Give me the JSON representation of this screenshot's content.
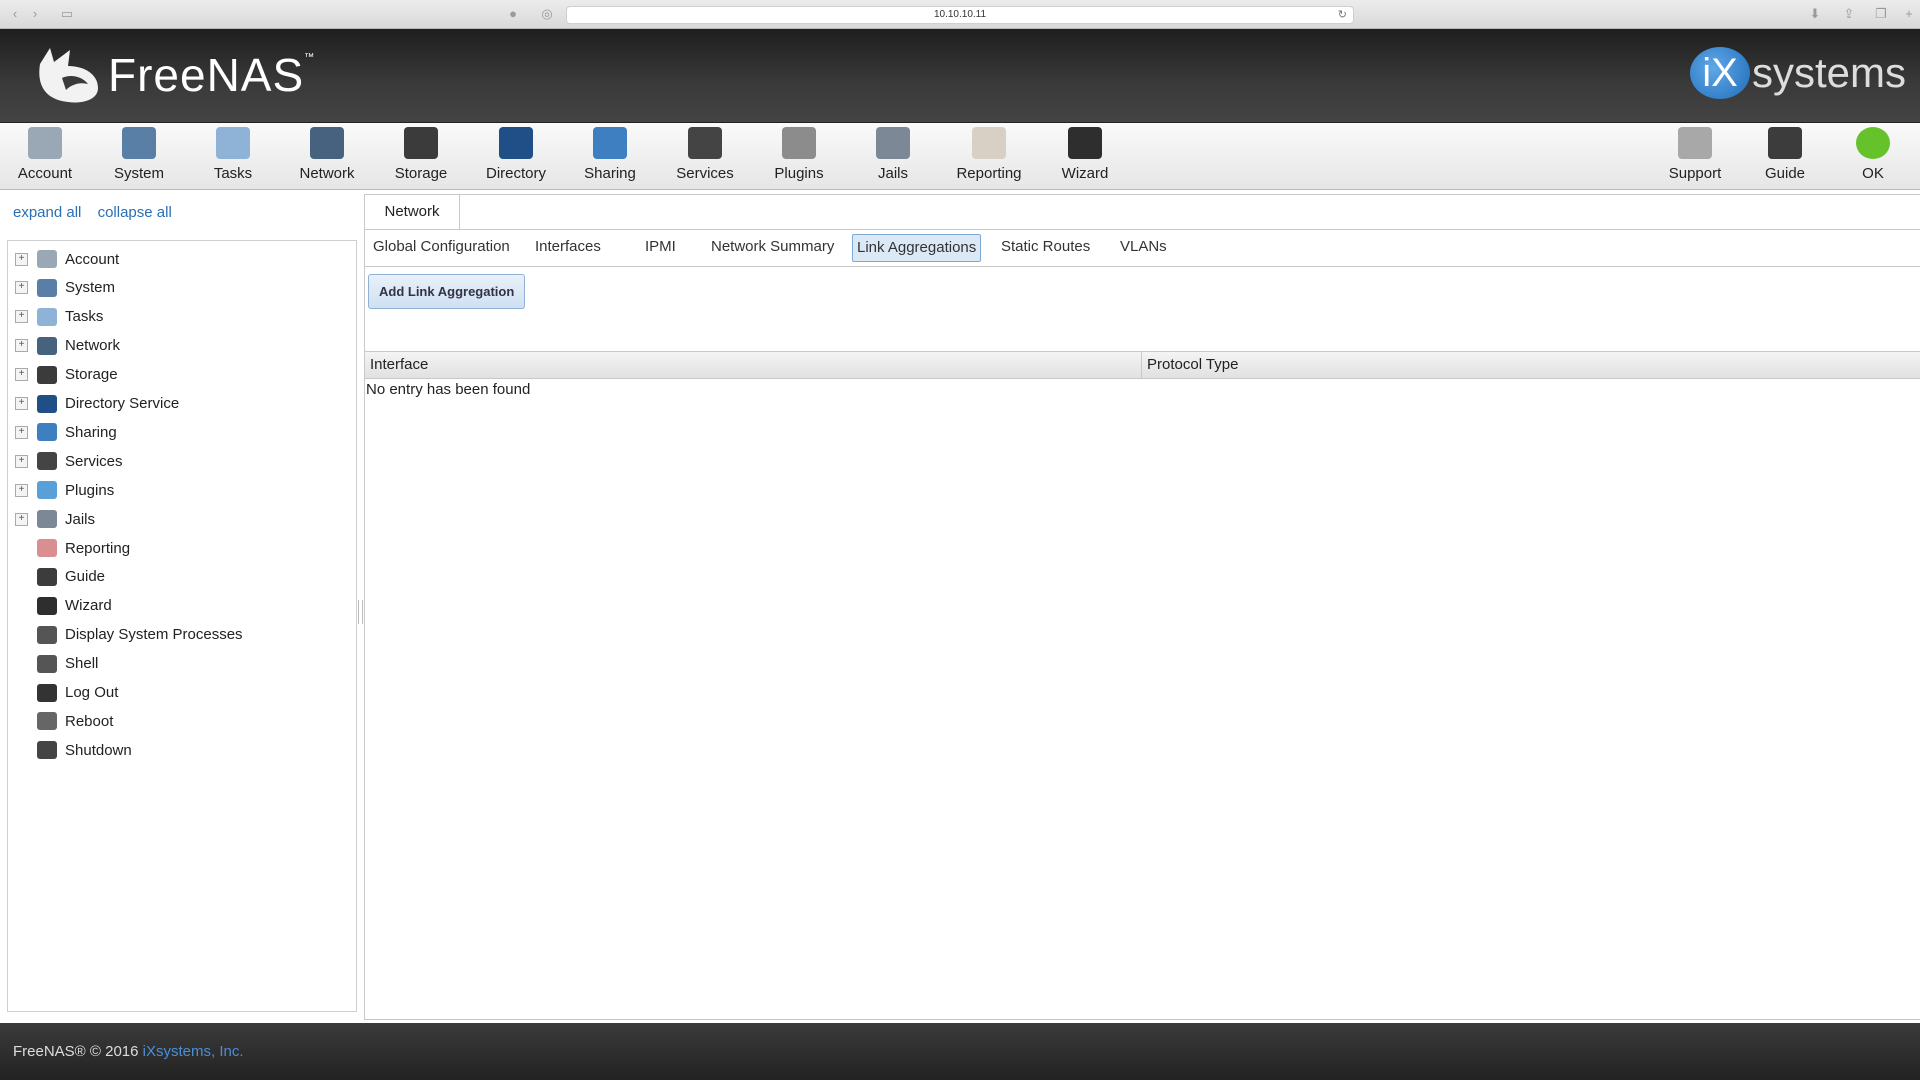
{
  "browser": {
    "url": "10.10.10.11"
  },
  "header": {
    "logo": "FreeNAS",
    "logo_tm": "™",
    "vendor": "systems",
    "vendor_mark": "iX"
  },
  "toolbar": {
    "left": [
      {
        "label": "Account",
        "icon": "account-icon",
        "color": "#9aa7b5"
      },
      {
        "label": "System",
        "icon": "system-icon",
        "color": "#5a7fa6"
      },
      {
        "label": "Tasks",
        "icon": "tasks-icon",
        "color": "#8fb3d6"
      },
      {
        "label": "Network",
        "icon": "network-icon",
        "color": "#46627f"
      },
      {
        "label": "Storage",
        "icon": "storage-icon",
        "color": "#3b3b3b"
      },
      {
        "label": "Directory",
        "icon": "directory-icon",
        "color": "#1f4f86"
      },
      {
        "label": "Sharing",
        "icon": "sharing-icon",
        "color": "#3d7fc1"
      },
      {
        "label": "Services",
        "icon": "services-icon",
        "color": "#444"
      },
      {
        "label": "Plugins",
        "icon": "plugins-icon",
        "color": "#8c8c8c"
      },
      {
        "label": "Jails",
        "icon": "jails-icon",
        "color": "#7d8896"
      },
      {
        "label": "Reporting",
        "icon": "reporting-icon",
        "color": "#d9d0c5"
      },
      {
        "label": "Wizard",
        "icon": "wizard-icon",
        "color": "#2e2e2e"
      }
    ],
    "right": [
      {
        "label": "Support",
        "icon": "support-icon",
        "color": "#a8a8a8"
      },
      {
        "label": "Guide",
        "icon": "guide-icon",
        "color": "#3c3c3c"
      },
      {
        "label": "OK",
        "icon": "ok-icon",
        "color": "#66c22b"
      }
    ]
  },
  "sidebar": {
    "expand_all": "expand all",
    "collapse_all": "collapse all",
    "items": [
      {
        "label": "Account",
        "expandable": true,
        "icon": "account-icon",
        "color": "#9aa7b5"
      },
      {
        "label": "System",
        "expandable": true,
        "icon": "system-icon",
        "color": "#5a7fa6"
      },
      {
        "label": "Tasks",
        "expandable": true,
        "icon": "tasks-icon",
        "color": "#8fb3d6"
      },
      {
        "label": "Network",
        "expandable": true,
        "icon": "network-icon",
        "color": "#46627f"
      },
      {
        "label": "Storage",
        "expandable": true,
        "icon": "storage-icon",
        "color": "#3b3b3b"
      },
      {
        "label": "Directory Service",
        "expandable": true,
        "icon": "directory-icon",
        "color": "#1f4f86"
      },
      {
        "label": "Sharing",
        "expandable": true,
        "icon": "sharing-icon",
        "color": "#3d7fc1"
      },
      {
        "label": "Services",
        "expandable": true,
        "icon": "services-icon",
        "color": "#444"
      },
      {
        "label": "Plugins",
        "expandable": true,
        "icon": "plugins-icon",
        "color": "#5aa0d8"
      },
      {
        "label": "Jails",
        "expandable": true,
        "icon": "jails-icon",
        "color": "#7d8896"
      },
      {
        "label": "Reporting",
        "expandable": false,
        "icon": "reporting-icon",
        "color": "#d98f8f"
      },
      {
        "label": "Guide",
        "expandable": false,
        "icon": "guide-icon",
        "color": "#3c3c3c"
      },
      {
        "label": "Wizard",
        "expandable": false,
        "icon": "wizard-icon",
        "color": "#2e2e2e"
      },
      {
        "label": "Display System Processes",
        "expandable": false,
        "icon": "processes-icon",
        "color": "#555"
      },
      {
        "label": "Shell",
        "expandable": false,
        "icon": "shell-icon",
        "color": "#555"
      },
      {
        "label": "Log Out",
        "expandable": false,
        "icon": "logout-icon",
        "color": "#333"
      },
      {
        "label": "Reboot",
        "expandable": false,
        "icon": "reboot-icon",
        "color": "#666"
      },
      {
        "label": "Shutdown",
        "expandable": false,
        "icon": "shutdown-icon",
        "color": "#444"
      }
    ]
  },
  "main": {
    "outer_tab": "Network",
    "tabs": [
      {
        "label": "Global Configuration",
        "active": false
      },
      {
        "label": "Interfaces",
        "active": false
      },
      {
        "label": "IPMI",
        "active": false
      },
      {
        "label": "Network Summary",
        "active": false
      },
      {
        "label": "Link Aggregations",
        "active": true
      },
      {
        "label": "Static Routes",
        "active": false
      },
      {
        "label": "VLANs",
        "active": false
      }
    ],
    "add_button": "Add Link Aggregation",
    "columns": [
      "Interface",
      "Protocol Type"
    ],
    "empty_message": "No entry has been found"
  },
  "footer": {
    "text": "FreeNAS® © 2016 ",
    "link": "iXsystems, Inc."
  }
}
